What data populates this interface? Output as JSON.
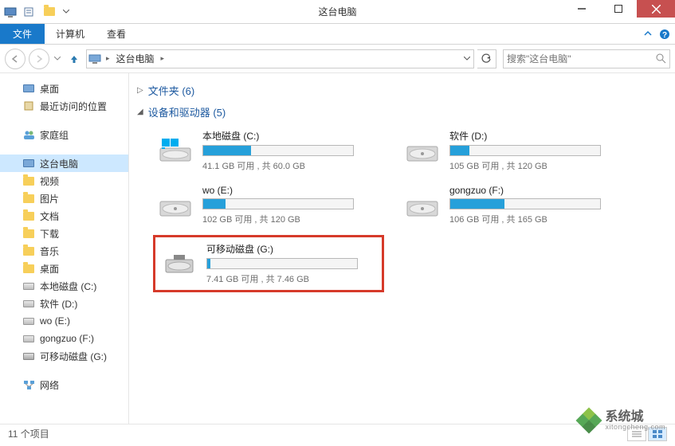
{
  "window": {
    "title": "这台电脑"
  },
  "ribbon": {
    "file": "文件",
    "tabs": [
      "计算机",
      "查看"
    ]
  },
  "nav": {
    "breadcrumb": "这台电脑",
    "search_placeholder": "搜索\"这台电脑\""
  },
  "tree": {
    "favorites": [
      {
        "label": "桌面",
        "icon": "desktop"
      },
      {
        "label": "最近访问的位置",
        "icon": "recent"
      }
    ],
    "homegroup": {
      "label": "家庭组"
    },
    "thispc": {
      "label": "这台电脑",
      "children": [
        {
          "label": "视频",
          "icon": "folder"
        },
        {
          "label": "图片",
          "icon": "folder"
        },
        {
          "label": "文档",
          "icon": "folder"
        },
        {
          "label": "下载",
          "icon": "folder"
        },
        {
          "label": "音乐",
          "icon": "folder"
        },
        {
          "label": "桌面",
          "icon": "folder"
        },
        {
          "label": "本地磁盘 (C:)",
          "icon": "hdd"
        },
        {
          "label": "软件 (D:)",
          "icon": "hdd"
        },
        {
          "label": "wo (E:)",
          "icon": "hdd"
        },
        {
          "label": "gongzuo (F:)",
          "icon": "hdd"
        },
        {
          "label": "可移动磁盘 (G:)",
          "icon": "usb"
        }
      ]
    },
    "network": {
      "label": "网络"
    }
  },
  "sections": {
    "folders": {
      "title": "文件夹 (6)",
      "expanded": false
    },
    "drives": {
      "title": "设备和驱动器 (5)",
      "expanded": true
    }
  },
  "drives": [
    {
      "name": "本地磁盘 (C:)",
      "free": "41.1 GB 可用 , 共 60.0 GB",
      "fill_pct": 32,
      "icon": "hdd-os",
      "highlight": false
    },
    {
      "name": "软件 (D:)",
      "free": "105 GB 可用 , 共 120 GB",
      "fill_pct": 13,
      "icon": "hdd",
      "highlight": false
    },
    {
      "name": "wo (E:)",
      "free": "102 GB 可用 , 共 120 GB",
      "fill_pct": 15,
      "icon": "hdd",
      "highlight": false
    },
    {
      "name": "gongzuo (F:)",
      "free": "106 GB 可用 , 共 165 GB",
      "fill_pct": 36,
      "icon": "hdd",
      "highlight": false
    },
    {
      "name": "可移动磁盘 (G:)",
      "free": "7.41 GB 可用 , 共 7.46 GB",
      "fill_pct": 2,
      "icon": "usb",
      "highlight": true
    }
  ],
  "status": {
    "left": "11 个项目"
  },
  "watermark": {
    "line1": "系统城",
    "line2": "xitongcheng.com"
  }
}
